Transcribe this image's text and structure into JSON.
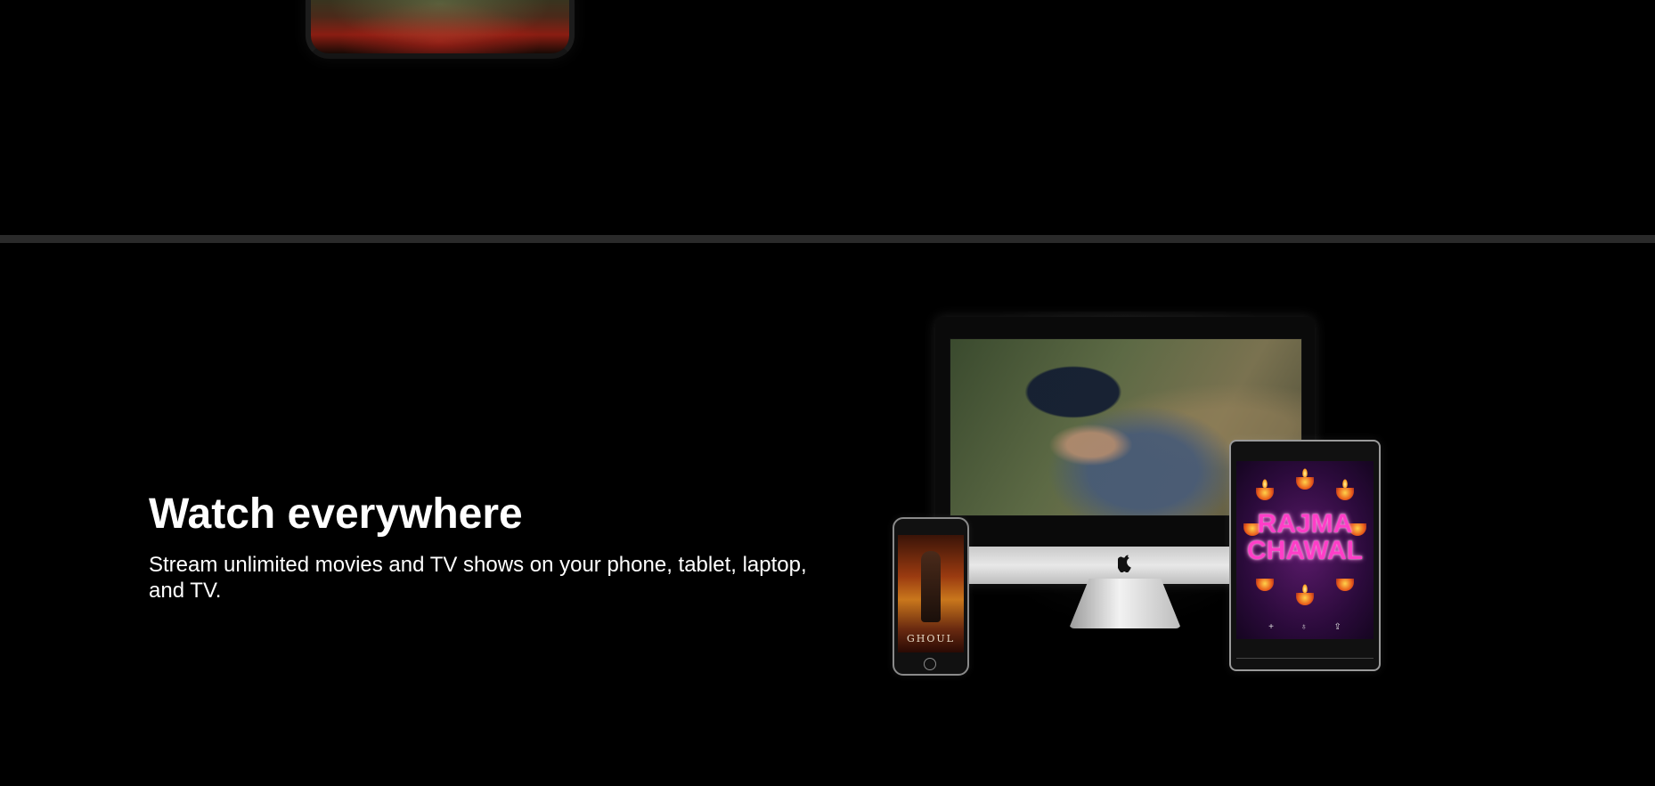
{
  "feature": {
    "title": "Watch everywhere",
    "subtitle": "Stream unlimited movies and TV shows on your phone, tablet, laptop, and TV."
  },
  "devices": {
    "phone_poster_title": "GHOUL",
    "tablet_poster_title_line1": "RAJMA",
    "tablet_poster_title_line2": "CHAWAL",
    "tablet_nav": [
      "+",
      "♁",
      "⇪"
    ]
  },
  "colors": {
    "background": "#000000",
    "divider": "#2a2a2a",
    "text": "#ffffff",
    "poster_accent": "#ff3ec8"
  }
}
